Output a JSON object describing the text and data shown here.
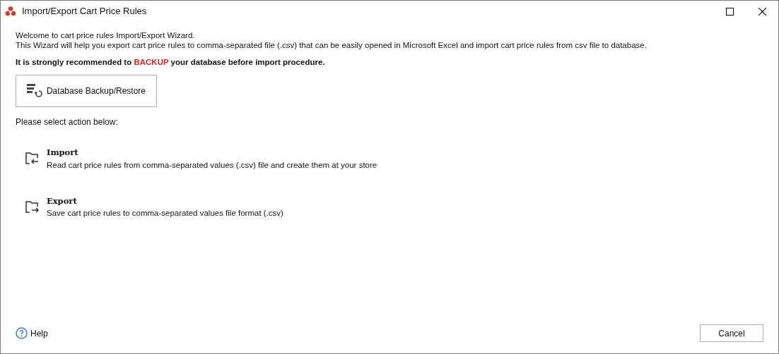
{
  "window": {
    "title": "Import/Export Cart Price Rules"
  },
  "intro": [
    "Welcome to cart price rules Import/Export Wizard.",
    "This Wizard will help you export cart price rules to comma-separated file (.csv) that can be easily opened in Microsoft Excel and import cart price rules from csv file to database."
  ],
  "warning": {
    "before": "It is strongly recommended to ",
    "highlight": "BACKUP",
    "after": " your database before import procedure."
  },
  "backup_button": {
    "label": "Database Backup/Restore"
  },
  "prompt": "Please select action below:",
  "actions": [
    {
      "kind": "import",
      "title": "Import",
      "description": "Read cart price rules from comma-separated values (.csv) file and create them at your store"
    },
    {
      "kind": "export",
      "title": "Export",
      "description": "Save cart price rules to comma-separated values file format (.csv)"
    }
  ],
  "footer": {
    "help": "Help",
    "cancel": "Cancel"
  }
}
